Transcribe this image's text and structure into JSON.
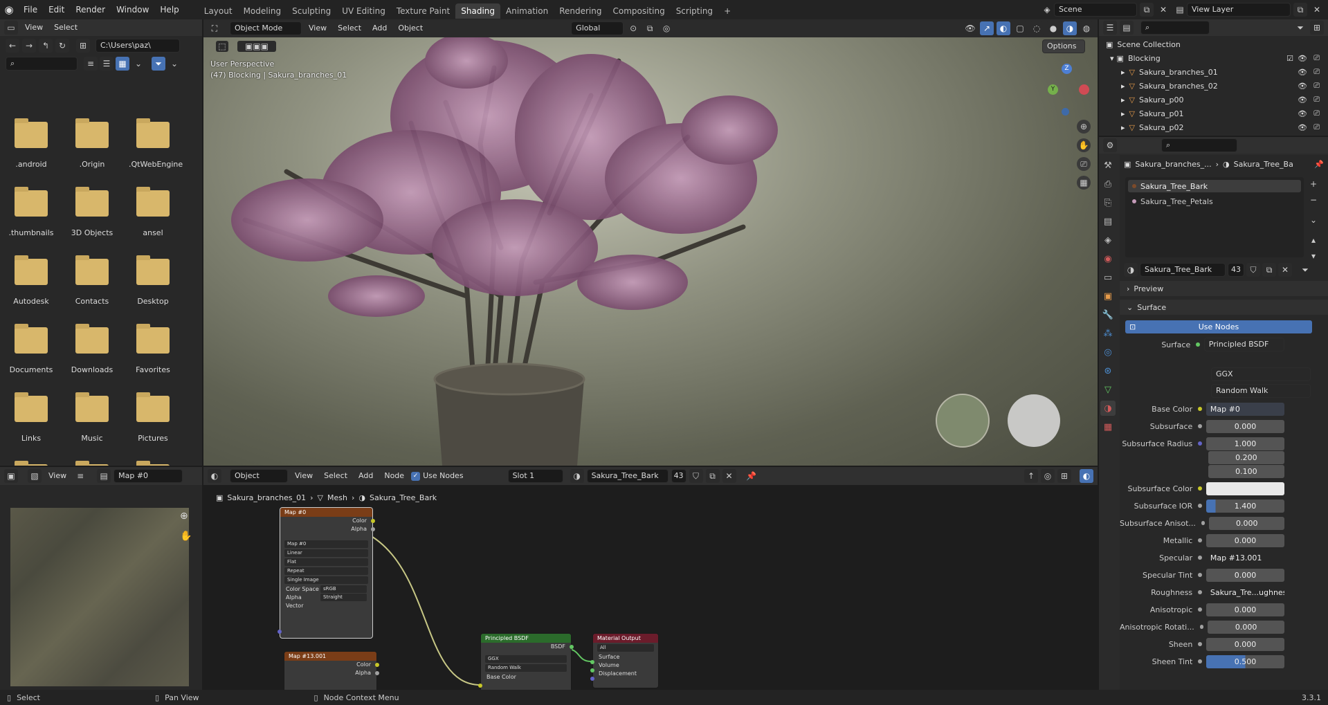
{
  "topbar": {
    "menus": [
      "File",
      "Edit",
      "Render",
      "Window",
      "Help"
    ],
    "workspaces": [
      "Layout",
      "Modeling",
      "Sculpting",
      "UV Editing",
      "Texture Paint",
      "Shading",
      "Animation",
      "Rendering",
      "Compositing",
      "Scripting"
    ],
    "active_workspace": "Shading",
    "add_tab": "+",
    "scene": "Scene",
    "view_layer": "View Layer"
  },
  "file_browser": {
    "menus": [
      "View",
      "Select"
    ],
    "path": "C:\\Users\\paz\\",
    "folders": [
      ".android",
      ".Origin",
      ".QtWebEngine",
      ".thumbnails",
      "3D Objects",
      "ansel",
      "Autodesk",
      "Contacts",
      "Desktop",
      "Documents",
      "Downloads",
      "Favorites",
      "Links",
      "Music",
      "Pictures"
    ]
  },
  "image_editor": {
    "view": "View",
    "image_name": "Map #0"
  },
  "viewport": {
    "mode": "Object Mode",
    "menus": [
      "View",
      "Select",
      "Add",
      "Object"
    ],
    "transform": "Global",
    "options": "Options",
    "overlay_title": "User Perspective",
    "overlay_sub": "(47) Blocking | Sakura_branches_01",
    "gizmo": {
      "z": "Z",
      "y": "Y",
      "x": ""
    }
  },
  "node_editor": {
    "type": "Object",
    "menus": [
      "View",
      "Select",
      "Add",
      "Node"
    ],
    "use_nodes": "Use Nodes",
    "slot": "Slot 1",
    "material": "Sakura_Tree_Bark",
    "users": "43",
    "breadcrumb": [
      "Sakura_branches_01",
      "Mesh",
      "Sakura_Tree_Bark"
    ],
    "node_map0": {
      "title": "Map #0",
      "out_color": "Color",
      "out_alpha": "Alpha",
      "image": "Map #0",
      "interp": "Linear",
      "proj": "Flat",
      "ext": "Repeat",
      "source": "Single Image",
      "cs_label": "Color Space",
      "cs_value": "sRGB",
      "alpha_label": "Alpha",
      "alpha_value": "Straight",
      "vector": "Vector"
    },
    "node_map13": {
      "title": "Map #13.001",
      "out_color": "Color",
      "out_alpha": "Alpha"
    },
    "node_bsdf": {
      "title": "Principled BSDF",
      "out": "BSDF",
      "dist": "GGX",
      "sss": "Random Walk",
      "base": "Base Color"
    },
    "node_output": {
      "title": "Material Output",
      "target": "All",
      "surface": "Surface",
      "volume": "Volume",
      "displacement": "Displacement"
    }
  },
  "outliner": {
    "collection": "Scene Collection",
    "items": [
      "Blocking",
      "Sakura_branches_01",
      "Sakura_branches_02",
      "Sakura_p00",
      "Sakura_p01",
      "Sakura_p02"
    ]
  },
  "properties": {
    "crumb_obj": "Sakura_branches_...",
    "crumb_mat": "Sakura_Tree_Ba",
    "slots": [
      "Sakura_Tree_Bark",
      "Sakura_Tree_Petals"
    ],
    "material": "Sakura_Tree_Bark",
    "users": "43",
    "preview": "Preview",
    "surface_panel": "Surface",
    "use_nodes": "Use Nodes",
    "surface_label": "Surface",
    "surface_value": "Principled BSDF",
    "dist": "GGX",
    "sss_method": "Random Walk",
    "rows": [
      {
        "label": "Base Color",
        "value": "Map #0",
        "kind": "link"
      },
      {
        "label": "Subsurface",
        "value": "0.000",
        "kind": "num"
      },
      {
        "label": "Subsurface Radius",
        "value": "1.000",
        "kind": "num"
      },
      {
        "label": "",
        "value": "0.200",
        "kind": "num"
      },
      {
        "label": "",
        "value": "0.100",
        "kind": "num"
      },
      {
        "label": "Subsurface Color",
        "value": "",
        "kind": "color"
      },
      {
        "label": "Subsurface IOR",
        "value": "1.400",
        "kind": "num"
      },
      {
        "label": "Subsurface Anisot...",
        "value": "0.000",
        "kind": "num"
      },
      {
        "label": "Metallic",
        "value": "0.000",
        "kind": "num"
      },
      {
        "label": "Specular",
        "value": "Map #13.001",
        "kind": "link"
      },
      {
        "label": "Specular Tint",
        "value": "0.000",
        "kind": "num"
      },
      {
        "label": "Roughness",
        "value": "Sakura_Tre...ughness.jpe",
        "kind": "link"
      },
      {
        "label": "Anisotropic",
        "value": "0.000",
        "kind": "num"
      },
      {
        "label": "Anisotropic Rotati...",
        "value": "0.000",
        "kind": "num"
      },
      {
        "label": "Sheen",
        "value": "0.000",
        "kind": "num"
      },
      {
        "label": "Sheen Tint",
        "value": "0.500",
        "kind": "num"
      }
    ]
  },
  "statusbar": {
    "select": "Select",
    "pan": "Pan View",
    "context": "Node Context Menu",
    "version": "3.3.1"
  },
  "colors": {
    "accent": "#4772b3",
    "folder": "#d8b76b",
    "bark": "#7c4b2a",
    "petal": "#a0648c"
  }
}
